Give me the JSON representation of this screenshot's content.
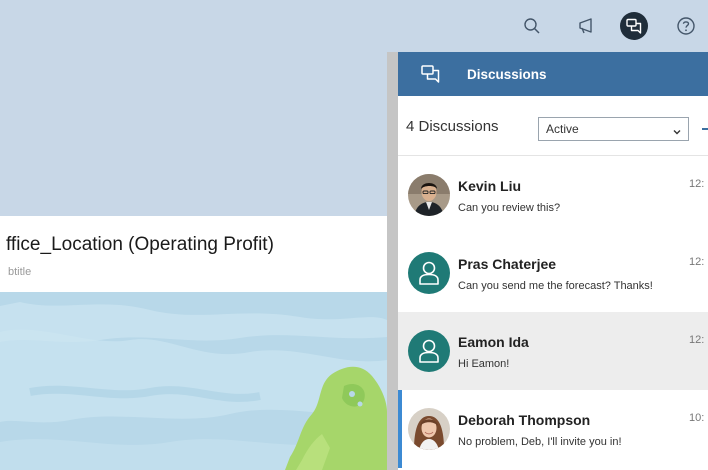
{
  "widget": {
    "title": "ffice_Location (Operating Profit)",
    "subtitle": "btitle"
  },
  "panel": {
    "title": "Discussions",
    "count_label": "4 Discussions",
    "filter": {
      "selected": "Active"
    }
  },
  "discussions": [
    {
      "name": "Kevin Liu",
      "message": "Can you review this?",
      "time": "12:",
      "avatar": "photo"
    },
    {
      "name": "Pras Chaterjee",
      "message": "Can you send me the forecast? Thanks!",
      "time": "12:",
      "avatar": "generic-user-icon"
    },
    {
      "name": "Eamon Ida",
      "message": "Hi Eamon!",
      "time": "12:",
      "avatar": "generic-user-icon"
    },
    {
      "name": "Deborah Thompson",
      "message": "No problem, Deb, I'll invite you in!",
      "time": "10:",
      "avatar": "photo"
    }
  ],
  "colors": {
    "shell": "#c8d7e7",
    "panel_header": "#3c6fa0",
    "avatar_generic": "#1f7a76",
    "selection_marker": "#3c8ad3"
  }
}
